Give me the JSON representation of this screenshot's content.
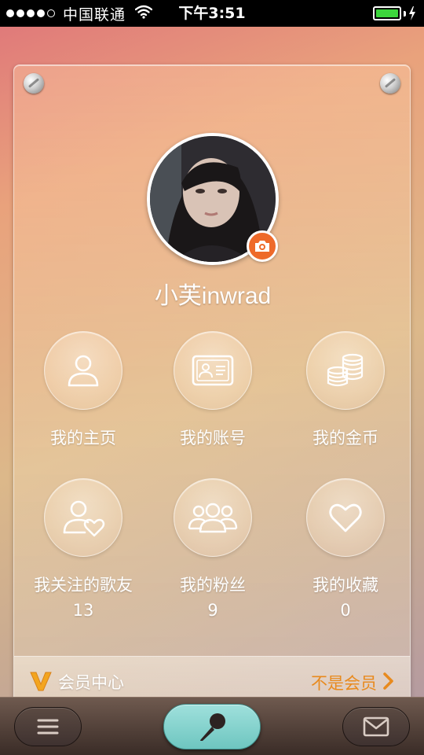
{
  "status_bar": {
    "carrier": "中国联通",
    "time": "下午3:51",
    "signal_bars_filled": 4,
    "signal_bars_total": 5,
    "battery_level": 1.0,
    "battery_color": "#3cd63c"
  },
  "profile": {
    "username": "小芙inwrad",
    "avatar_icon": "user-photo",
    "camera_icon": "camera-icon",
    "accent_color": "#ee6a2a"
  },
  "grid": [
    {
      "label": "我的主页",
      "count": "",
      "icon": "person-icon"
    },
    {
      "label": "我的账号",
      "count": "",
      "icon": "id-card-icon"
    },
    {
      "label": "我的金币",
      "count": "",
      "icon": "coins-icon"
    },
    {
      "label": "我关注的歌友",
      "count": "13",
      "icon": "person-heart-icon"
    },
    {
      "label": "我的粉丝",
      "count": "9",
      "icon": "group-icon"
    },
    {
      "label": "我的收藏",
      "count": "0",
      "icon": "heart-icon"
    }
  ],
  "vip": {
    "title": "会员中心",
    "status": "不是会员",
    "status_color": "#e88a1e"
  },
  "toolbar": {
    "menu_icon": "menu-icon",
    "search_icon": "microphone-icon",
    "mail_icon": "mail-icon"
  }
}
